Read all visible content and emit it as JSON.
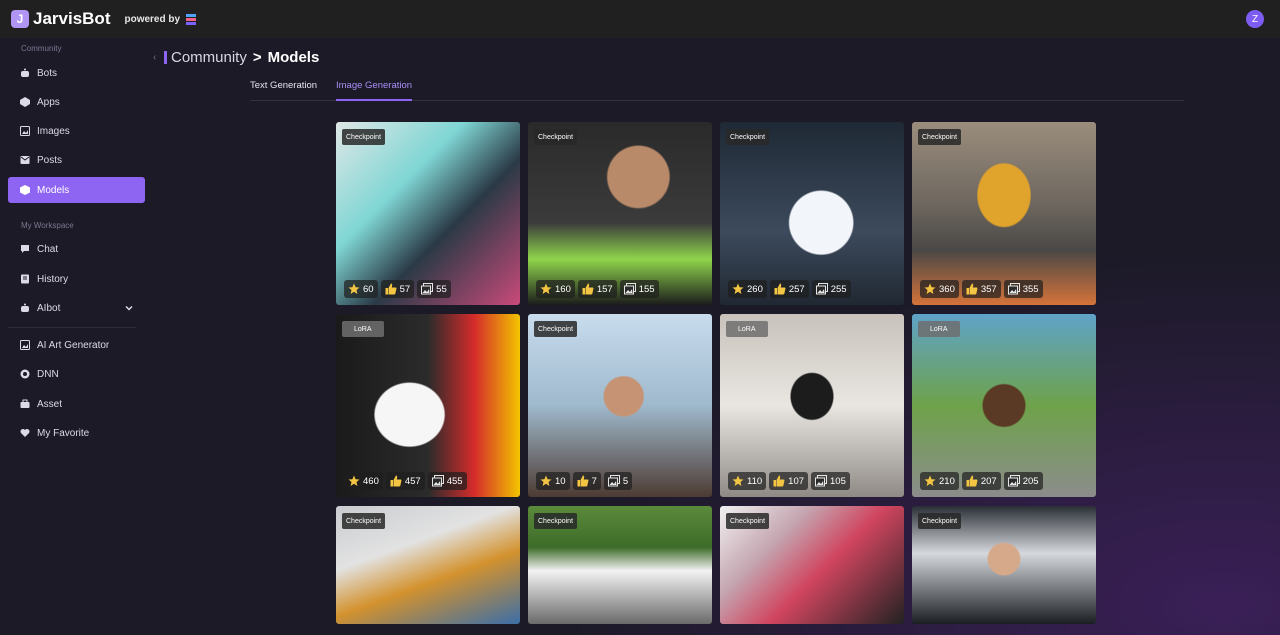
{
  "app": {
    "brand": "JarvisBot",
    "brand_logo": "J",
    "powered_by": "powered by",
    "user_initial": "Z",
    "accent": "#8e65f2"
  },
  "sidebar": {
    "section_community": "Community",
    "community_items": [
      {
        "label": "Bots",
        "icon": "bot-icon"
      },
      {
        "label": "Apps",
        "icon": "apps-icon"
      },
      {
        "label": "Images",
        "icon": "image-icon"
      },
      {
        "label": "Posts",
        "icon": "posts-icon"
      },
      {
        "label": "Models",
        "icon": "models-icon",
        "active": true
      }
    ],
    "section_workspace": "My Workspace",
    "workspace_items": [
      {
        "label": "Chat",
        "icon": "chat-icon"
      },
      {
        "label": "History",
        "icon": "history-icon"
      },
      {
        "label": "AIbot",
        "icon": "aibot-icon"
      }
    ],
    "extra_items": [
      {
        "label": "AI Art Generator",
        "icon": "art-icon"
      },
      {
        "label": "DNN",
        "icon": "dnn-icon"
      },
      {
        "label": "Asset",
        "icon": "asset-icon"
      },
      {
        "label": "My Favorite",
        "icon": "heart-icon"
      }
    ]
  },
  "breadcrumb": {
    "parent": "Community",
    "separator": ">",
    "current": "Models"
  },
  "tabs": [
    {
      "label": "Text Generation",
      "active": false
    },
    {
      "label": "Image Generation",
      "active": true
    }
  ],
  "cards": [
    {
      "badge": "Checkpoint",
      "stars": "60",
      "likes": "57",
      "images": "55",
      "theme": "anime-cyan"
    },
    {
      "badge": "Checkpoint",
      "stars": "160",
      "likes": "157",
      "images": "155",
      "theme": "woman-green"
    },
    {
      "badge": "Checkpoint",
      "stars": "260",
      "likes": "257",
      "images": "255",
      "theme": "white-dog"
    },
    {
      "badge": "Checkpoint",
      "stars": "360",
      "likes": "357",
      "images": "355",
      "theme": "yellow-car"
    },
    {
      "badge": "LoRA",
      "stars": "460",
      "likes": "457",
      "images": "455",
      "theme": "dog-red"
    },
    {
      "badge": "Checkpoint",
      "stars": "10",
      "likes": "7",
      "images": "5",
      "theme": "woman-sky"
    },
    {
      "badge": "LoRA",
      "stars": "110",
      "likes": "107",
      "images": "105",
      "theme": "dog-bw"
    },
    {
      "badge": "LoRA",
      "stars": "210",
      "likes": "207",
      "images": "205",
      "theme": "dog-street"
    },
    {
      "badge": "Checkpoint",
      "stars": null,
      "likes": null,
      "images": null,
      "theme": "orange-car"
    },
    {
      "badge": "Checkpoint",
      "stars": null,
      "likes": null,
      "images": null,
      "theme": "white-car"
    },
    {
      "badge": "Checkpoint",
      "stars": null,
      "likes": null,
      "images": null,
      "theme": "anime-red"
    },
    {
      "badge": "Checkpoint",
      "stars": null,
      "likes": null,
      "images": null,
      "theme": "woman-studio"
    }
  ]
}
